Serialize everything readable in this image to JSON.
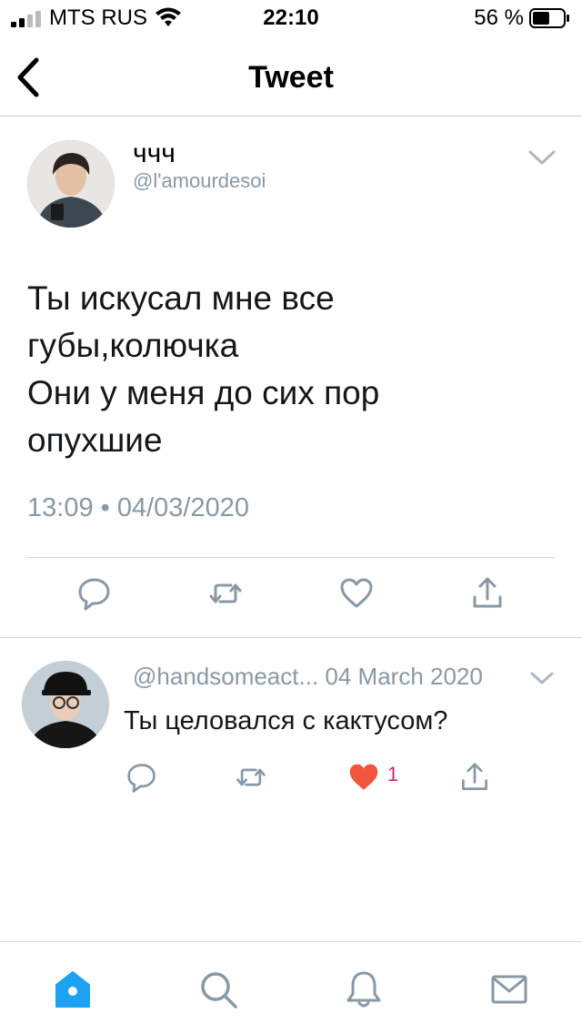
{
  "status_bar": {
    "carrier": "MTS RUS",
    "time": "22:10",
    "battery_percent": "56 %",
    "battery_level": 0.56
  },
  "nav": {
    "title": "Tweet",
    "back_icon": "chevron-left-icon"
  },
  "tweet": {
    "author_name": "ччч",
    "author_handle": "@l'amourdesoi",
    "text_lines": [
      "Ты искусал мне все",
      "губы,колючка",
      "Они у меня до сих пор",
      "опухшие"
    ],
    "timestamp": "13:09 • 04/03/2020",
    "actions": [
      "reply-icon",
      "retweet-icon",
      "like-icon",
      "share-icon"
    ]
  },
  "reply": {
    "handle": "@handsomeact...",
    "date": "04 March 2020",
    "text": "Ты целовался с кактусом?",
    "like_count": "1",
    "liked": true
  },
  "tab_bar": {
    "items": [
      "home-icon",
      "search-icon",
      "notifications-icon",
      "messages-icon"
    ],
    "active": "home-icon"
  },
  "colors": {
    "accent": "#1da1f2",
    "like": "#e0245e",
    "secondary_text": "#8899a6",
    "icon_gray": "#8899a6"
  }
}
